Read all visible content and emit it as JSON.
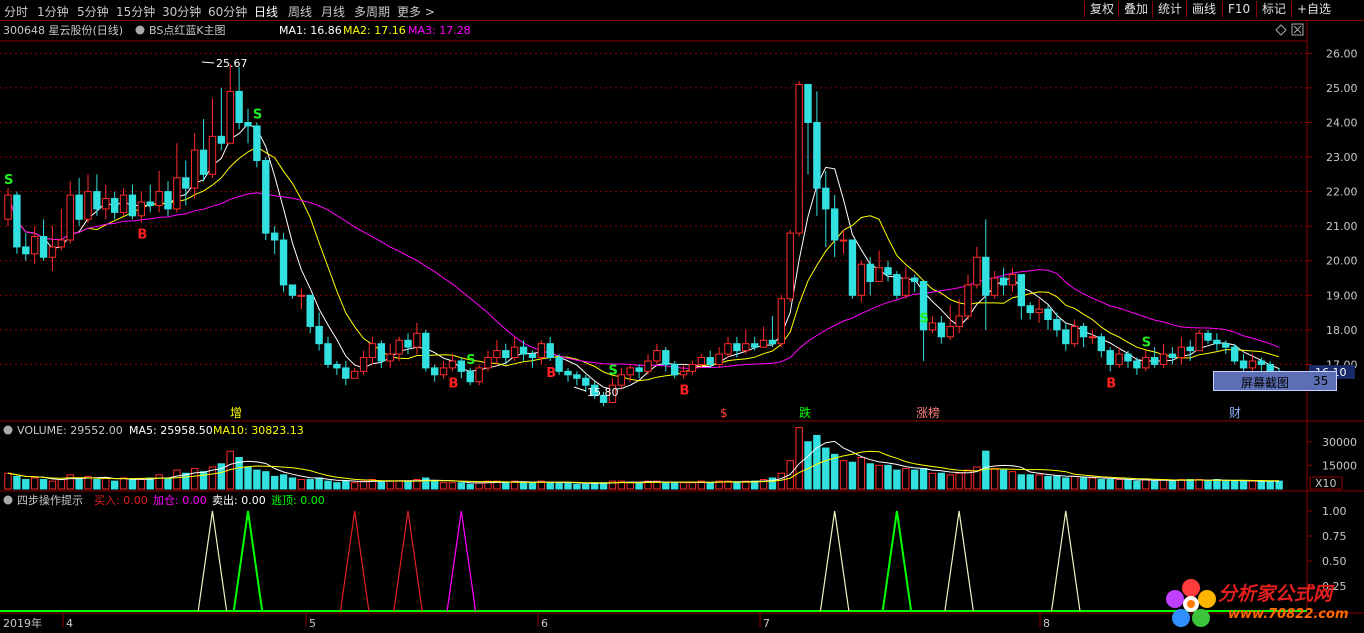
{
  "toolbar": {
    "periods": [
      "分时",
      "1分钟",
      "5分钟",
      "15分钟",
      "30分钟",
      "60分钟",
      "日线",
      "周线",
      "月线",
      "多周期",
      "更多 >"
    ],
    "active_period": "日线",
    "tools": [
      "复权",
      "叠加",
      "统计",
      "画线",
      "F10",
      "标记",
      "+自选"
    ]
  },
  "main_panel": {
    "stock": "300648 星云股份(日线)",
    "indicator_name": "BS点红蓝K主图",
    "ma": [
      {
        "label": "MA1: 16.86",
        "color": "#ffffff"
      },
      {
        "label": "MA2: 17.16",
        "color": "#ffff00"
      },
      {
        "label": "MA3: 17.28",
        "color": "#ff00ff"
      }
    ],
    "peak_label": "25.67",
    "trough_label": "15.80",
    "event_labels": [
      "增",
      "$",
      "跌",
      "涨榜",
      "财"
    ],
    "last_price": "16.10",
    "screenshot_tip": {
      "label": "屏幕截图",
      "value": "35"
    }
  },
  "volume_panel": {
    "title": "VOLUME: 29552.00",
    "ma5": "MA5: 25958.50",
    "ma10": "MA10: 30823.13",
    "unit": "X10",
    "ticks": [
      "30000",
      "15000"
    ]
  },
  "signal_panel": {
    "title": "四步操作提示",
    "legend": [
      {
        "label": "买入: 0.00",
        "color": "#e02020"
      },
      {
        "label": "加仓: 0.00",
        "color": "#ff00ff"
      },
      {
        "label": "卖出: 0.00",
        "color": "#ffffff"
      },
      {
        "label": "逃顶: 0.00",
        "color": "#00ff00"
      }
    ],
    "ticks": [
      "1.00",
      "0.75",
      "0.50",
      "0.25"
    ]
  },
  "x_axis": {
    "labels": [
      "2019年",
      "4",
      "5",
      "6",
      "7",
      "8"
    ]
  },
  "watermark": {
    "title": "分析家公式网",
    "url": "www.70822.com"
  },
  "colors": {
    "up": "#ff2a2a",
    "down": "#33e0e0",
    "grid": "#8b0000",
    "ma1": "#ffffff",
    "ma2": "#ffff00",
    "ma3": "#ff00ff"
  },
  "chart_data": {
    "type": "candlestick",
    "price_axis": {
      "ticks": [
        17,
        18,
        19,
        20,
        21,
        22,
        23,
        24,
        25,
        26
      ],
      "range": [
        16.0,
        26.3
      ]
    },
    "volume_axis": {
      "ticks": [
        15000,
        30000
      ],
      "range": [
        0,
        40000
      ]
    },
    "signal_axis": {
      "ticks": [
        0.25,
        0.5,
        0.75,
        1.0
      ],
      "range": [
        0,
        1.0
      ]
    },
    "candles": [
      [
        21.2,
        21.9,
        22.1,
        21.0
      ],
      [
        21.9,
        20.4,
        22.0,
        20.2
      ],
      [
        20.4,
        20.2,
        20.8,
        20.0
      ],
      [
        20.2,
        20.7,
        21.0,
        19.9
      ],
      [
        20.7,
        20.1,
        21.2,
        20.0
      ],
      [
        20.1,
        20.4,
        21.0,
        19.7
      ],
      [
        20.4,
        20.6,
        21.5,
        20.3
      ],
      [
        20.6,
        21.9,
        22.3,
        20.5
      ],
      [
        21.9,
        21.2,
        22.4,
        21.0
      ],
      [
        21.2,
        22.0,
        22.5,
        21.1
      ],
      [
        22.0,
        21.5,
        22.5,
        21.3
      ],
      [
        21.5,
        21.8,
        22.2,
        21.2
      ],
      [
        21.8,
        21.4,
        22.0,
        21.2
      ],
      [
        21.4,
        21.9,
        22.1,
        21.3
      ],
      [
        21.9,
        21.3,
        22.2,
        21.2
      ],
      [
        21.3,
        21.7,
        22.0,
        21.1
      ],
      [
        21.7,
        21.6,
        22.2,
        21.4
      ],
      [
        21.6,
        22.0,
        22.6,
        21.4
      ],
      [
        22.0,
        21.5,
        22.3,
        21.3
      ],
      [
        21.5,
        22.4,
        23.4,
        21.4
      ],
      [
        22.4,
        22.1,
        22.9,
        21.6
      ],
      [
        22.1,
        23.2,
        23.7,
        21.8
      ],
      [
        23.2,
        22.5,
        24.1,
        22.3
      ],
      [
        22.5,
        23.6,
        24.7,
        22.4
      ],
      [
        23.6,
        23.4,
        25.0,
        23.2
      ],
      [
        23.4,
        24.9,
        25.7,
        23.6
      ],
      [
        24.9,
        24.0,
        25.6,
        23.8
      ],
      [
        24.0,
        23.9,
        24.4,
        23.4
      ],
      [
        23.9,
        22.9,
        24.0,
        22.7
      ],
      [
        22.9,
        20.8,
        23.0,
        20.6
      ],
      [
        20.8,
        20.6,
        21.0,
        20.2
      ],
      [
        20.6,
        19.3,
        20.8,
        19.1
      ],
      [
        19.3,
        19.0,
        19.3,
        18.9
      ],
      [
        19.0,
        19.0,
        19.2,
        18.6
      ],
      [
        19.0,
        18.1,
        19.0,
        17.9
      ],
      [
        18.1,
        17.6,
        18.5,
        17.4
      ],
      [
        17.6,
        17.0,
        17.8,
        16.9
      ],
      [
        17.0,
        16.9,
        17.1,
        16.7
      ],
      [
        16.9,
        16.6,
        17.1,
        16.4
      ],
      [
        16.6,
        16.8,
        16.9,
        16.6
      ],
      [
        16.8,
        17.2,
        17.4,
        16.7
      ],
      [
        17.2,
        17.6,
        17.8,
        17.0
      ],
      [
        17.6,
        17.1,
        17.7,
        16.9
      ],
      [
        17.1,
        17.3,
        17.6,
        16.9
      ],
      [
        17.3,
        17.7,
        17.8,
        17.1
      ],
      [
        17.7,
        17.5,
        17.9,
        17.3
      ],
      [
        17.5,
        17.9,
        18.2,
        17.3
      ],
      [
        17.9,
        16.9,
        18.0,
        16.8
      ],
      [
        16.9,
        16.7,
        17.0,
        16.5
      ],
      [
        16.7,
        16.9,
        17.1,
        16.6
      ],
      [
        16.9,
        17.1,
        17.3,
        16.8
      ],
      [
        17.1,
        16.8,
        17.2,
        16.6
      ],
      [
        16.8,
        16.5,
        16.9,
        16.4
      ],
      [
        16.5,
        16.9,
        17.0,
        16.4
      ],
      [
        16.9,
        17.2,
        17.4,
        16.8
      ],
      [
        17.2,
        17.4,
        17.7,
        17.0
      ],
      [
        17.4,
        17.2,
        17.6,
        17.0
      ],
      [
        17.2,
        17.5,
        17.8,
        17.1
      ],
      [
        17.5,
        17.3,
        17.7,
        17.1
      ],
      [
        17.3,
        17.2,
        17.4,
        16.9
      ],
      [
        17.2,
        17.6,
        17.7,
        17.0
      ],
      [
        17.6,
        17.2,
        17.8,
        17.1
      ],
      [
        17.2,
        16.8,
        17.3,
        16.7
      ],
      [
        16.8,
        16.7,
        16.9,
        16.5
      ],
      [
        16.7,
        16.6,
        16.8,
        16.4
      ],
      [
        16.6,
        16.4,
        16.7,
        16.2
      ],
      [
        16.4,
        16.1,
        16.5,
        16.0
      ],
      [
        16.1,
        15.9,
        16.2,
        15.8
      ],
      [
        15.9,
        16.4,
        16.6,
        15.9
      ],
      [
        16.4,
        16.7,
        16.9,
        16.3
      ],
      [
        16.7,
        16.9,
        17.0,
        16.5
      ],
      [
        16.9,
        16.8,
        17.0,
        16.6
      ],
      [
        16.8,
        17.1,
        17.3,
        16.7
      ],
      [
        17.1,
        17.4,
        17.6,
        17.0
      ],
      [
        17.4,
        17.0,
        17.5,
        16.8
      ],
      [
        17.0,
        16.7,
        17.1,
        16.6
      ],
      [
        16.7,
        16.8,
        17.0,
        16.6
      ],
      [
        16.8,
        17.0,
        17.1,
        16.7
      ],
      [
        17.0,
        17.2,
        17.3,
        16.9
      ],
      [
        17.2,
        17.0,
        17.4,
        16.9
      ],
      [
        17.0,
        17.3,
        17.5,
        16.9
      ],
      [
        17.3,
        17.6,
        17.8,
        17.2
      ],
      [
        17.6,
        17.4,
        17.8,
        17.2
      ],
      [
        17.4,
        17.6,
        18.0,
        17.3
      ],
      [
        17.6,
        17.5,
        17.8,
        17.4
      ],
      [
        17.5,
        17.7,
        18.1,
        17.5
      ],
      [
        17.7,
        17.6,
        18.4,
        17.5
      ],
      [
        17.6,
        18.9,
        19.0,
        17.5
      ],
      [
        18.9,
        20.8,
        20.9,
        18.8
      ],
      [
        20.8,
        25.1,
        25.2,
        20.7
      ],
      [
        25.1,
        24.0,
        24.9,
        22.5
      ],
      [
        24.0,
        22.1,
        24.9,
        21.3
      ],
      [
        22.1,
        21.5,
        22.6,
        20.4
      ],
      [
        21.5,
        20.6,
        21.9,
        20.1
      ],
      [
        20.6,
        20.6,
        20.9,
        20.2
      ],
      [
        20.6,
        19.0,
        19.9,
        18.9
      ],
      [
        19.0,
        19.9,
        20.0,
        18.8
      ],
      [
        19.9,
        19.4,
        20.1,
        19.0
      ],
      [
        19.4,
        19.8,
        20.3,
        19.5
      ],
      [
        19.8,
        19.6,
        20.0,
        19.4
      ],
      [
        19.6,
        19.0,
        19.7,
        18.9
      ],
      [
        19.0,
        19.5,
        19.8,
        18.9
      ],
      [
        19.5,
        19.4,
        19.6,
        19.1
      ],
      [
        19.4,
        18.0,
        18.1,
        17.1
      ],
      [
        18.0,
        18.2,
        18.4,
        17.9
      ],
      [
        18.2,
        17.8,
        18.4,
        17.6
      ],
      [
        17.8,
        18.1,
        18.7,
        17.7
      ],
      [
        18.1,
        18.4,
        18.9,
        17.9
      ],
      [
        18.4,
        19.3,
        19.6,
        18.3
      ],
      [
        19.3,
        20.1,
        20.4,
        19.2
      ],
      [
        20.1,
        19.0,
        21.2,
        18.0
      ],
      [
        19.0,
        19.5,
        19.7,
        18.9
      ],
      [
        19.5,
        19.3,
        19.8,
        19.0
      ],
      [
        19.3,
        19.6,
        19.8,
        19.1
      ],
      [
        19.6,
        18.7,
        19.0,
        18.3
      ],
      [
        18.7,
        18.5,
        18.8,
        18.3
      ],
      [
        18.5,
        18.6,
        18.9,
        18.2
      ],
      [
        18.6,
        18.3,
        18.7,
        18.0
      ],
      [
        18.3,
        18.0,
        18.5,
        17.8
      ],
      [
        18.0,
        17.6,
        18.2,
        17.4
      ],
      [
        17.6,
        18.1,
        18.3,
        17.5
      ],
      [
        18.1,
        17.8,
        18.2,
        17.5
      ],
      [
        17.8,
        17.8,
        18.0,
        17.6
      ],
      [
        17.8,
        17.4,
        17.9,
        17.2
      ],
      [
        17.4,
        17.0,
        17.5,
        16.8
      ],
      [
        17.0,
        17.3,
        17.5,
        16.9
      ],
      [
        17.3,
        17.1,
        17.4,
        16.9
      ],
      [
        17.1,
        16.9,
        17.2,
        16.7
      ],
      [
        16.9,
        17.2,
        17.4,
        16.8
      ],
      [
        17.2,
        17.0,
        17.5,
        16.9
      ],
      [
        17.0,
        17.3,
        17.6,
        16.9
      ],
      [
        17.3,
        17.2,
        17.5,
        17.0
      ],
      [
        17.2,
        17.5,
        17.8,
        17.0
      ],
      [
        17.5,
        17.4,
        17.7,
        17.1
      ],
      [
        17.4,
        17.9,
        18.0,
        17.4
      ],
      [
        17.9,
        17.7,
        18.0,
        17.6
      ],
      [
        17.7,
        17.6,
        17.9,
        17.4
      ],
      [
        17.6,
        17.5,
        17.7,
        17.3
      ],
      [
        17.5,
        17.1,
        17.6,
        17.0
      ],
      [
        17.1,
        16.9,
        17.3,
        16.8
      ],
      [
        16.9,
        17.1,
        17.3,
        16.8
      ],
      [
        17.1,
        17.0,
        17.2,
        16.7
      ],
      [
        17.0,
        16.8,
        17.1,
        16.6
      ],
      [
        16.8,
        16.6,
        16.9,
        16.4
      ]
    ],
    "volumes": [
      10,
      8,
      6,
      7,
      6,
      5,
      6,
      9,
      7,
      8,
      6,
      7,
      5,
      7,
      6,
      6,
      7,
      9,
      7,
      12,
      10,
      13,
      11,
      14,
      16,
      24,
      20,
      14,
      12,
      11,
      8,
      9,
      7,
      6,
      6,
      7,
      5,
      4,
      5,
      4,
      5,
      6,
      5,
      5,
      5,
      5,
      6,
      7,
      5,
      4,
      4,
      4,
      3,
      4,
      5,
      5,
      4,
      5,
      4,
      4,
      5,
      4,
      4,
      4,
      3,
      3,
      4,
      4,
      5,
      5,
      4,
      4,
      5,
      5,
      4,
      4,
      4,
      4,
      5,
      4,
      5,
      5,
      4,
      5,
      5,
      6,
      7,
      10,
      18,
      39,
      30,
      34,
      26,
      22,
      18,
      17,
      20,
      16,
      15,
      15,
      12,
      13,
      12,
      13,
      10,
      10,
      9,
      10,
      12,
      14,
      24,
      13,
      12,
      11,
      9,
      9,
      9,
      8,
      8,
      7,
      8,
      7,
      7,
      6,
      6,
      6,
      6,
      5,
      6,
      5,
      6,
      5,
      6,
      6,
      6,
      5,
      6,
      5,
      5,
      5,
      5,
      5,
      5,
      5
    ],
    "signals": {
      "buy": [
        39,
        45
      ],
      "add": [
        51
      ],
      "sell": [
        23,
        93,
        107,
        119
      ],
      "top": [
        27,
        100
      ]
    },
    "buy_markers": [
      15,
      50,
      61,
      76,
      124,
      150
    ],
    "sell_markers": [
      0,
      28,
      52,
      68,
      103,
      128,
      160,
      164
    ]
  }
}
